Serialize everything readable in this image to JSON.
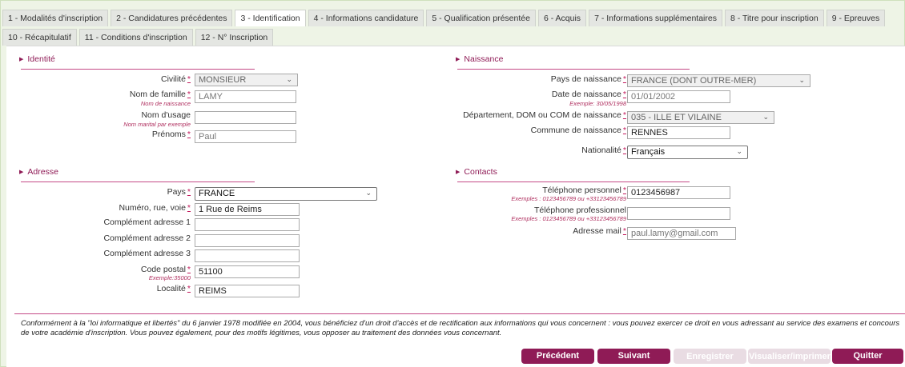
{
  "tabs": [
    [
      "1 - Modalités d'inscription",
      "2 - Candidatures précédentes",
      "3 - Identification",
      "4 - Informations candidature",
      "5 - Qualification présentée",
      "6 - Acquis",
      "7 - Informations supplémentaires",
      "8 - Titre pour inscription",
      "9 - Epreuves"
    ],
    [
      "10 - Récapitulatif",
      "11 - Conditions d'inscription",
      "12 - N° Inscription"
    ]
  ],
  "active_tab": "3 - Identification",
  "identite": {
    "title": "Identité",
    "civilite_label": "Civilité",
    "civilite_value": "MONSIEUR",
    "nom_label": "Nom de famille",
    "nom_hint": "Nom de naissance",
    "nom_value": "LAMY",
    "usage_label": "Nom d'usage",
    "usage_hint": "Nom marital par exemple",
    "usage_value": "",
    "prenoms_label": "Prénoms",
    "prenoms_value": "Paul"
  },
  "naissance": {
    "title": "Naissance",
    "pays_label": "Pays de naissance",
    "pays_value": "FRANCE (DONT OUTRE-MER)",
    "date_label": "Date de naissance",
    "date_hint": "Exemple: 30/05/1998",
    "date_value": "01/01/2002",
    "dept_label": "Département, DOM ou COM de naissance",
    "dept_value": "035 - ILLE ET VILAINE",
    "commune_label": "Commune de naissance",
    "commune_value": "RENNES",
    "nationalite_label": "Nationalité",
    "nationalite_value": "Français"
  },
  "adresse": {
    "title": "Adresse",
    "pays_label": "Pays",
    "pays_value": "FRANCE",
    "numero_label": "Numéro, rue, voie",
    "numero_value": "1 Rue de Reims",
    "comp1_label": "Complément adresse 1",
    "comp2_label": "Complément adresse 2",
    "comp3_label": "Complément adresse 3",
    "cp_label": "Code postal",
    "cp_hint": "Exemple:35000",
    "cp_value": "51100",
    "localite_label": "Localité",
    "localite_value": "REIMS"
  },
  "contacts": {
    "title": "Contacts",
    "tel_perso_label": "Téléphone personnel",
    "tel_perso_hint": "Exemples : 0123456789 ou +33123456789",
    "tel_perso_value": "0123456987",
    "tel_pro_label": "Téléphone professionnel",
    "tel_pro_hint": "Exemples : 0123456789 ou +33123456789",
    "tel_pro_value": "",
    "mail_label": "Adresse mail",
    "mail_value": "paul.lamy@gmail.com"
  },
  "notice": "Conformément à la \"loi informatique et libertés\" du 6 janvier 1978 modifiée en 2004, vous bénéficiez d'un droit d'accès et de rectification aux informations qui vous concernent : vous pouvez exercer ce droit en vous adressant au service des examens et concours de votre académie d'inscription. Vous pouvez également, pour des motifs légitimes, vous opposer au traitement des données vous concernant.",
  "buttons": {
    "precedent": "Précédent",
    "suivant": "Suivant",
    "enregistrer": "Enregistrer",
    "visualiser": "Visualiser/imprimer",
    "quitter": "Quitter"
  },
  "colors": {
    "accent": "#8f1b56",
    "required": "#c2185b",
    "disabled": "#e9dce3"
  },
  "required_marker": "*"
}
